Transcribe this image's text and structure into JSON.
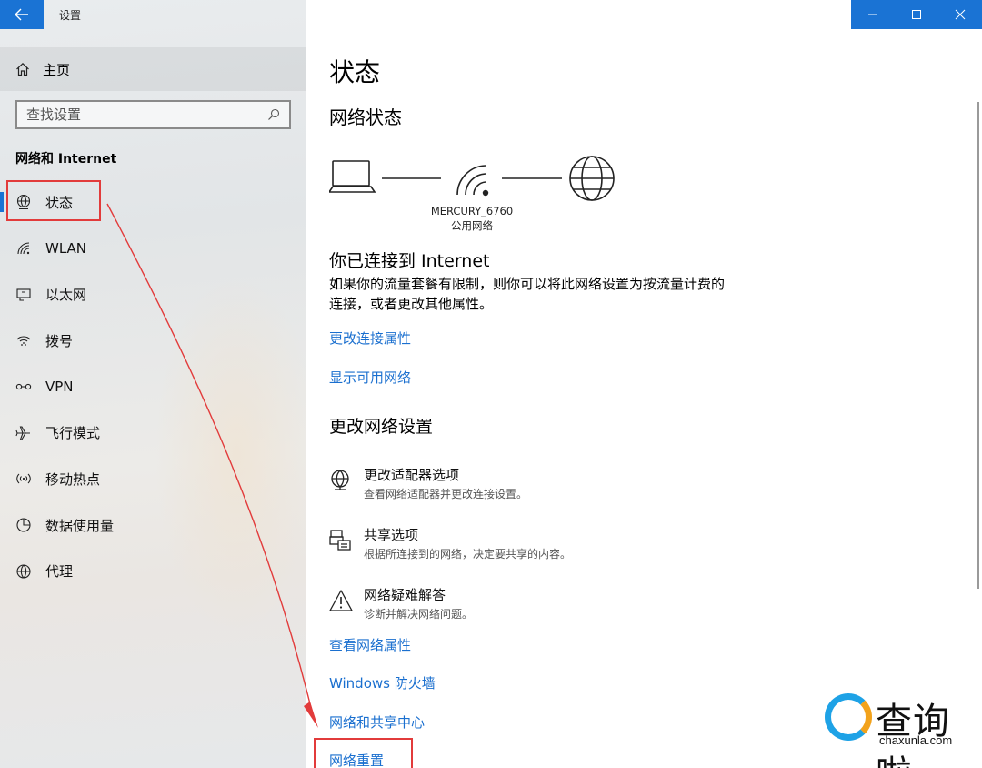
{
  "window": {
    "title": "设置",
    "back_icon": "arrow-left-icon",
    "accent": "#1a73d4"
  },
  "sidebar": {
    "home_label": "主页",
    "search_placeholder": "查找设置",
    "section_title": "网络和 Internet",
    "items": [
      {
        "label": "状态",
        "icon": "globe-status-icon",
        "active": true
      },
      {
        "label": "WLAN",
        "icon": "wifi-icon"
      },
      {
        "label": "以太网",
        "icon": "ethernet-icon"
      },
      {
        "label": "拨号",
        "icon": "dialup-icon"
      },
      {
        "label": "VPN",
        "icon": "vpn-icon"
      },
      {
        "label": "飞行模式",
        "icon": "airplane-icon"
      },
      {
        "label": "移动热点",
        "icon": "hotspot-icon"
      },
      {
        "label": "数据使用量",
        "icon": "data-usage-icon"
      },
      {
        "label": "代理",
        "icon": "globe-icon"
      }
    ]
  },
  "main": {
    "title": "状态",
    "network_status_heading": "网络状态",
    "network": {
      "name": "MERCURY_6760",
      "type": "公用网络"
    },
    "connected_heading": "你已连接到 Internet",
    "connected_desc": "如果你的流量套餐有限制，则你可以将此网络设置为按流量计费的连接，或者更改其他属性。",
    "link_change_props": "更改连接属性",
    "link_show_networks": "显示可用网络",
    "change_settings_heading": "更改网络设置",
    "options": [
      {
        "title": "更改适配器选项",
        "desc": "查看网络适配器并更改连接设置。",
        "icon": "adapter-globe-icon"
      },
      {
        "title": "共享选项",
        "desc": "根据所连接到的网络，决定要共享的内容。",
        "icon": "printer-share-icon"
      },
      {
        "title": "网络疑难解答",
        "desc": "诊断并解决网络问题。",
        "icon": "warning-icon"
      }
    ],
    "link_view_props": "查看网络属性",
    "link_firewall": "Windows 防火墙",
    "link_sharing_center": "网络和共享中心",
    "link_reset": "网络重置"
  },
  "watermark": {
    "text": "查询啦",
    "url": "chaxunla.com"
  },
  "annotation_color": "#e23b3b"
}
